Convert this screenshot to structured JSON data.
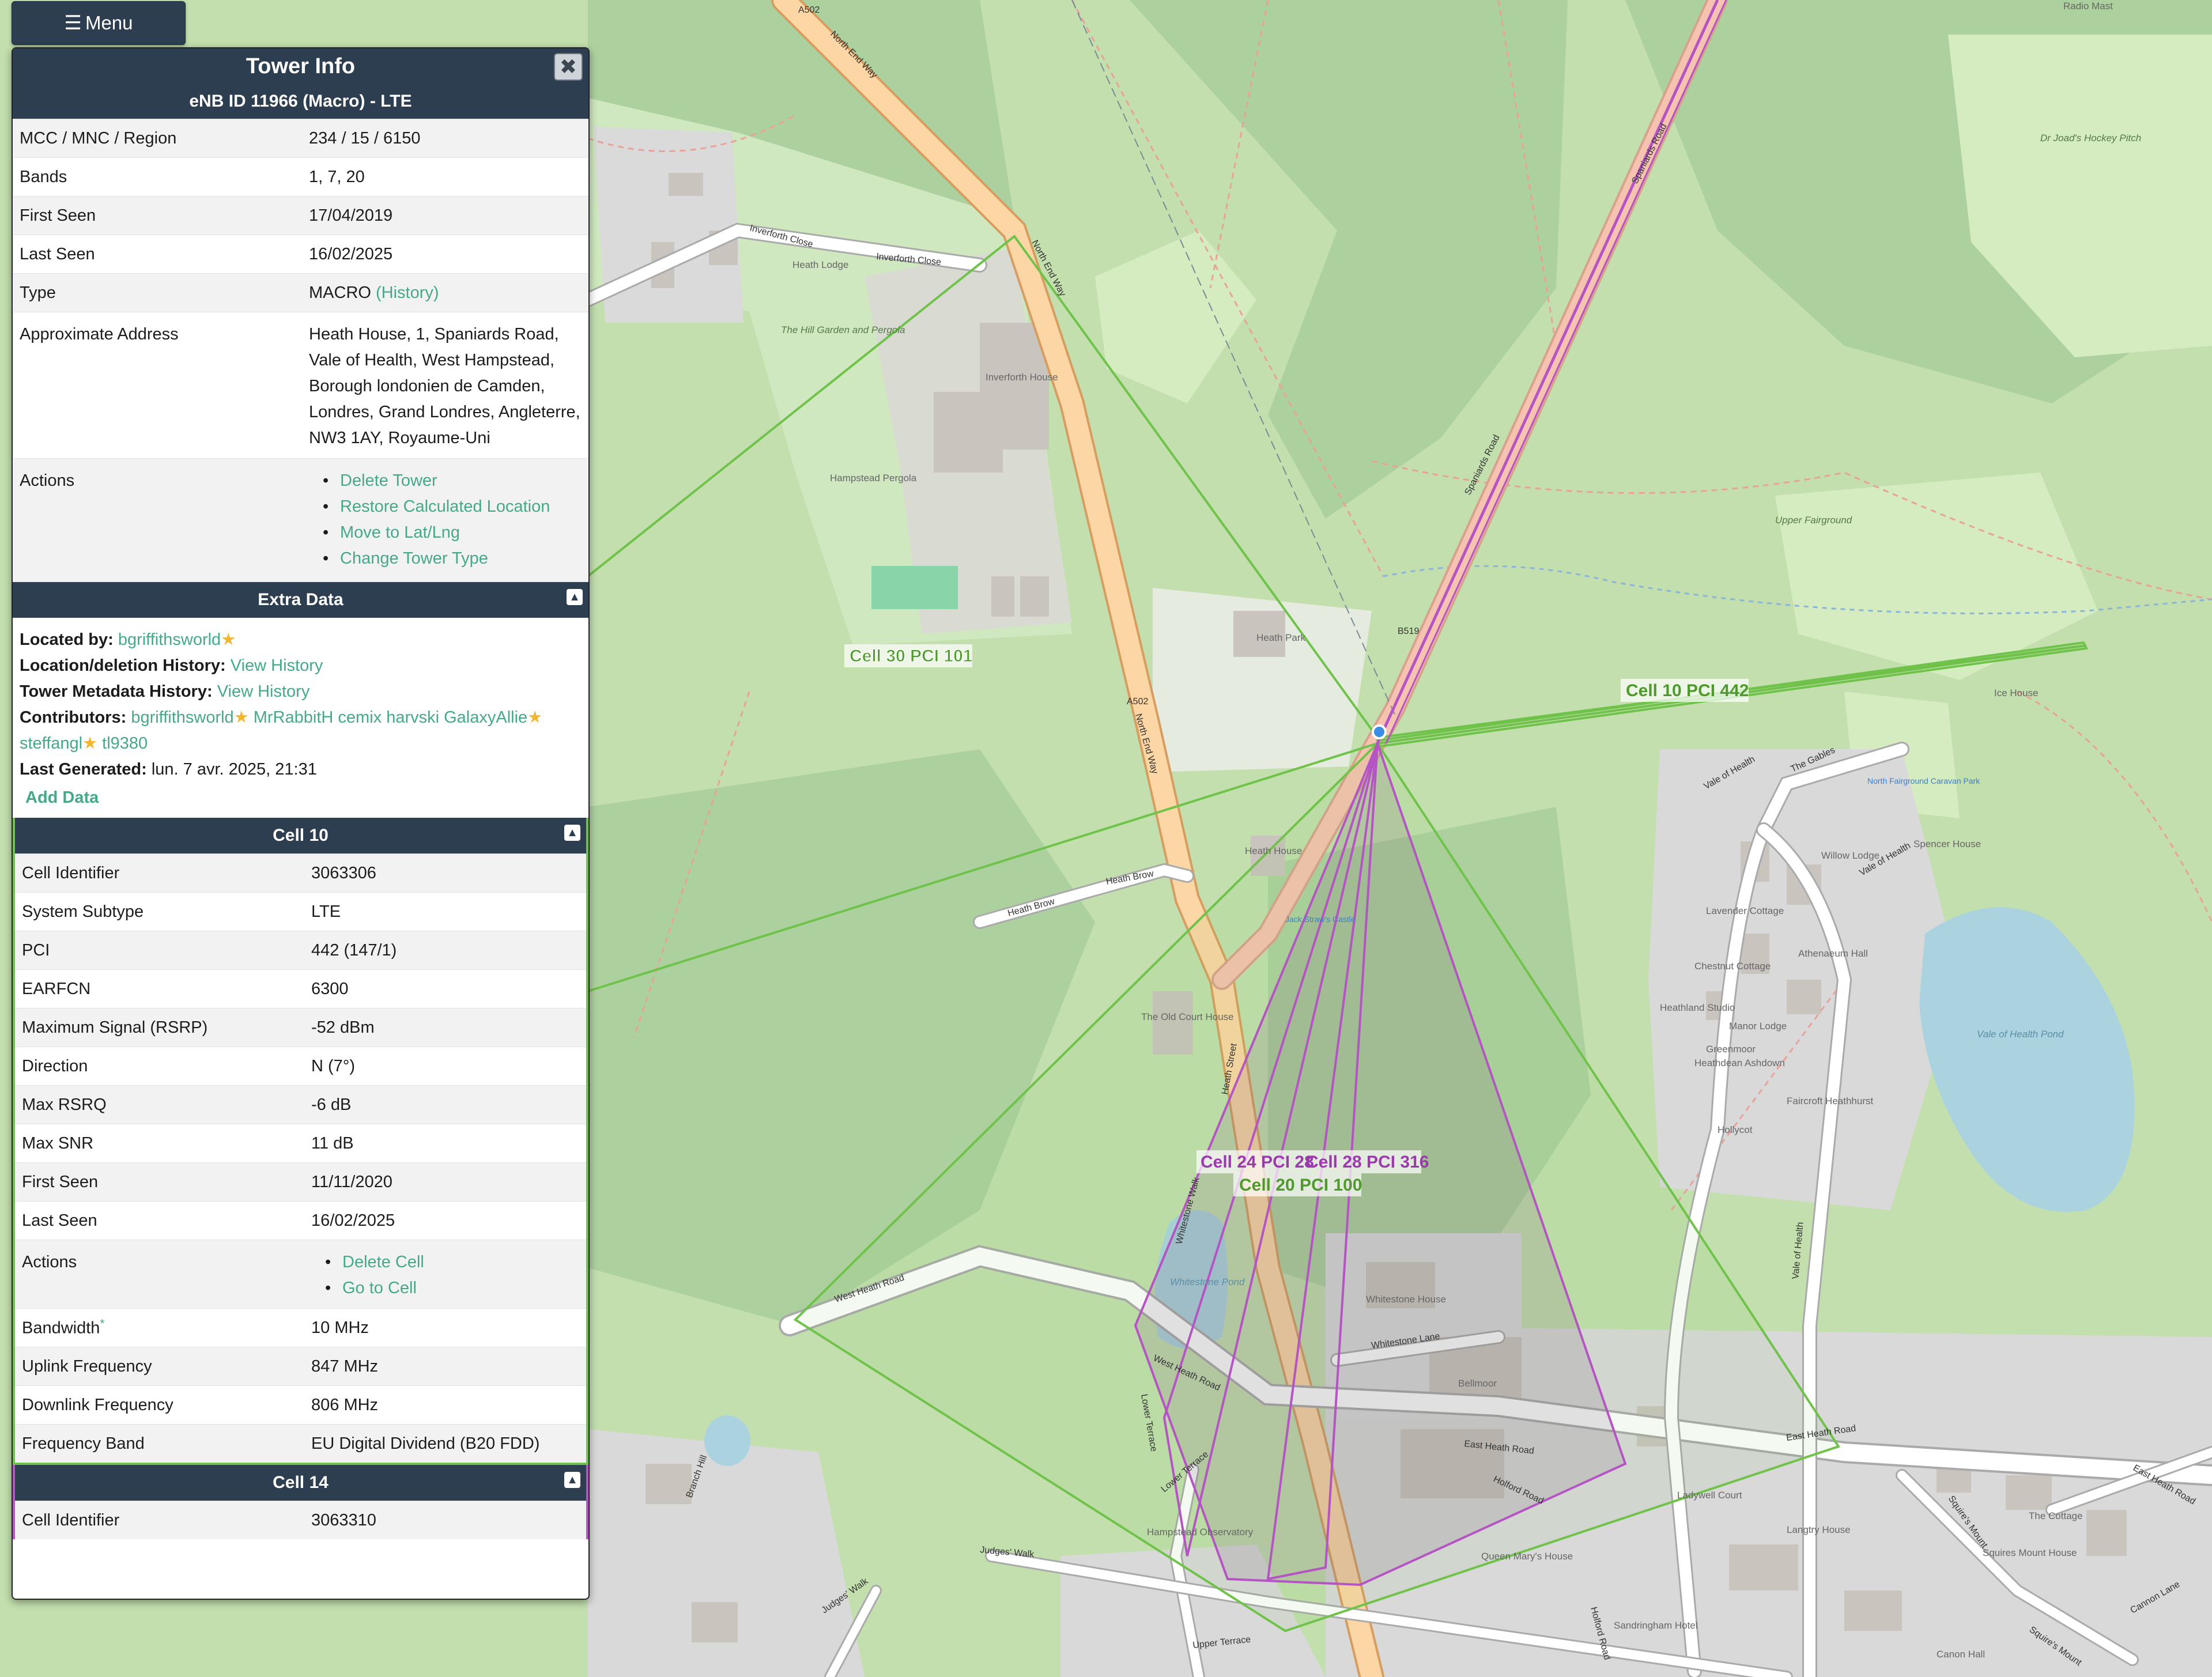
{
  "menu": {
    "label": "Menu"
  },
  "panel": {
    "title": "Tower Info",
    "header": "eNB ID 11966 (Macro) - LTE",
    "rows": {
      "mcc_label": "MCC / MNC / Region",
      "mcc_value": "234 / 15 / 6150",
      "bands_label": "Bands",
      "bands_value": "1, 7, 20",
      "first_seen_label": "First Seen",
      "first_seen_value": "17/04/2019",
      "last_seen_label": "Last Seen",
      "last_seen_value": "16/02/2025",
      "type_label": "Type",
      "type_value": "MACRO",
      "type_history": "(History)",
      "address_label": "Approximate Address",
      "address_lines": [
        "Heath House, 1, Spaniards Road,",
        "Vale of Health, West Hampstead,",
        "Borough londonien de Camden,",
        "Londres, Grand Londres, Angleterre,",
        "NW3 1AY, Royaume-Uni"
      ],
      "actions_label": "Actions",
      "actions": [
        "Delete Tower",
        "Restore Calculated Location",
        "Move to Lat/Lng",
        "Change Tower Type"
      ]
    }
  },
  "extra": {
    "title": "Extra Data",
    "located_by_label": "Located by:",
    "located_by": "bgriffithsworld",
    "loc_history_label": "Location/deletion History:",
    "loc_history_link": "View History",
    "meta_history_label": "Tower Metadata History:",
    "meta_history_link": "View History",
    "contributors_label": "Contributors:",
    "contributors_line1": "bgriffithsworld",
    "contributors_line1b": "MrRabbitH cemix harvski GalaxyAllie",
    "contributors_line2": "steffangl",
    "contributors_line2b": "tl9380",
    "last_generated_label": "Last Generated:",
    "last_generated": "lun. 7 avr. 2025, 21:31",
    "add_data": "Add Data"
  },
  "cell10": {
    "title": "Cell 10",
    "rows": [
      {
        "k": "Cell Identifier",
        "v": "3063306"
      },
      {
        "k": "System Subtype",
        "v": "LTE"
      },
      {
        "k": "PCI",
        "v": "442 (147/1)"
      },
      {
        "k": "EARFCN",
        "v": "6300"
      },
      {
        "k": "Maximum Signal (RSRP)",
        "v": "-52 dBm"
      },
      {
        "k": "Direction",
        "v": "N (7°)"
      },
      {
        "k": "Max RSRQ",
        "v": "-6 dB"
      },
      {
        "k": "Max SNR",
        "v": "11 dB"
      },
      {
        "k": "First Seen",
        "v": "11/11/2020"
      },
      {
        "k": "Last Seen",
        "v": "16/02/2025"
      }
    ],
    "actions_label": "Actions",
    "actions": [
      "Delete Cell",
      "Go to Cell"
    ],
    "rows2": [
      {
        "k": "Bandwidth",
        "v": "10 MHz"
      },
      {
        "k": "Uplink Frequency",
        "v": "847 MHz"
      },
      {
        "k": "Downlink Frequency",
        "v": "806 MHz"
      },
      {
        "k": "Frequency Band",
        "v": "EU Digital Dividend (B20 FDD)"
      }
    ],
    "bandwidth_mark": "*"
  },
  "cell14": {
    "title": "Cell 14",
    "rows": [
      {
        "k": "Cell Identifier",
        "v": "3063310"
      }
    ]
  },
  "map": {
    "cell_labels": [
      "Cell 30 PCI 101",
      "Cell 10 PCI 442",
      "Cell 24 PCI 28",
      "Cell 28 PCI 316",
      "Cell 20 PCI 100"
    ],
    "roads": [
      "North End Way",
      "A502",
      "Inverforth Close",
      "Spaniards Road",
      "B519",
      "Heath Brow",
      "Heath Street",
      "West Heath Road",
      "Whitestone Lane",
      "East Heath Road",
      "Vale of Health",
      "Lower Terrace",
      "Judges' Walk",
      "Upper Terrace",
      "Holford Road",
      "Squire's Mount",
      "Cannon Lane",
      "Branch Hill",
      "Whitestone Walk",
      "The Gables"
    ],
    "places": [
      "The Hill Garden and Pergola",
      "Inverforth House",
      "Hampstead Pergola",
      "Heath Park",
      "Heath House",
      "Vale of Health Pond",
      "Whitestone Pond",
      "Upper Fairground",
      "Ice House",
      "Dr Joad's Hockey Pitch",
      "Radio Mast",
      "North Fairground Caravan Park",
      "Bellmoor",
      "Whitestone House",
      "Hampstead Observatory",
      "Jack Straw's Castle",
      "The Old Court House",
      "Heath Lodge",
      "Lavender Cottage",
      "Chestnut Cottage",
      "Heathland Studio",
      "Manor Lodge",
      "Greenmoor",
      "Heathdean Ashdown",
      "Hollycot",
      "Spencer House",
      "Willow Lodge",
      "Athenaeum Hall",
      "Faircroft Heathhurst",
      "Ladywell Court",
      "Queen Mary's House",
      "Langtry House",
      "Sandringham Hotel",
      "The Cottage",
      "Squires Mount House",
      "Canon Hall"
    ]
  },
  "colors": {
    "panel_header": "#2c3e50",
    "link": "#45a88a",
    "cell_green": "#6fc24a",
    "cell_purple": "#b555c4"
  }
}
